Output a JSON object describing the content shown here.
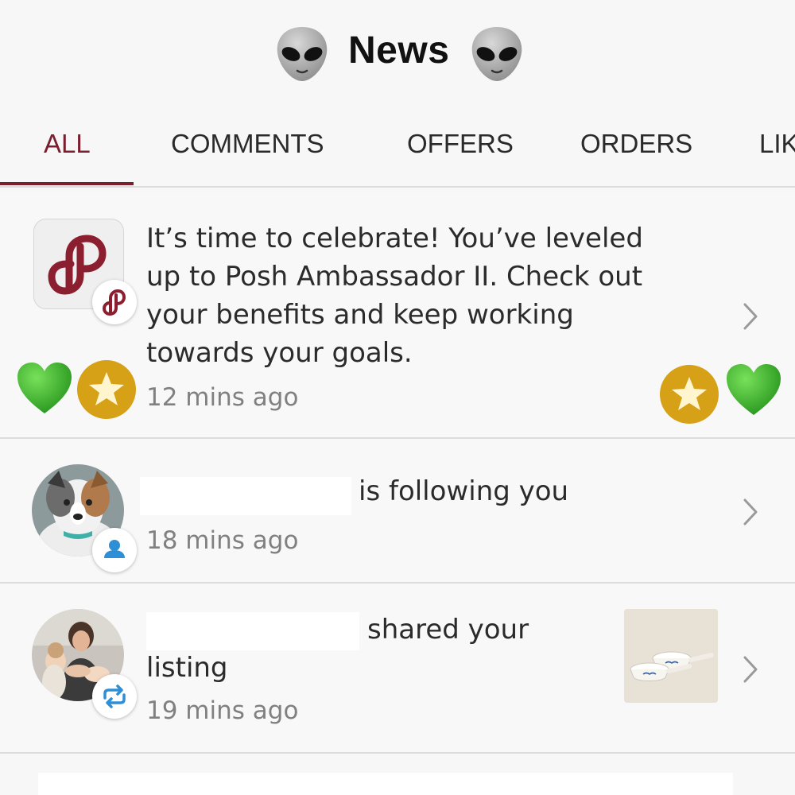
{
  "header": {
    "title": "News",
    "left_icon": "alien-emoji-icon",
    "right_icon": "alien-emoji-icon"
  },
  "tabs": [
    {
      "label": "ALL",
      "active": true
    },
    {
      "label": "COMMENTS",
      "active": false
    },
    {
      "label": "OFFERS",
      "active": false
    },
    {
      "label": "ORDERS",
      "active": false
    },
    {
      "label": "LIK",
      "active": false
    }
  ],
  "colors": {
    "accent": "#7b1e2e",
    "gold_badge": "#d6a017",
    "green_heart": "#3cb321",
    "meta_text": "#808080"
  },
  "notifications": [
    {
      "text": "It’s time to celebrate! You’ve leveled up to Posh Ambassador II. Check out your benefits and keep working towards your goals.",
      "lines": [
        "It’s time to celebrate! You’ve leveled",
        "up to Posh Ambassador II. Check out",
        "your benefits and keep working",
        "towards your goals."
      ],
      "time": "12 mins ago",
      "icon": "poshmark-logo-icon",
      "badge_icon": "poshmark-badge-icon",
      "decorations": [
        "green-heart-icon",
        "gold-star-icon"
      ]
    },
    {
      "text": "is following you",
      "time": "18 mins ago",
      "icon": "avatar",
      "badge_icon": "person-icon"
    },
    {
      "text_line1": "shared your",
      "text_line2": "listing",
      "time": "19 mins ago",
      "icon": "avatar",
      "badge_icon": "share-icon"
    }
  ]
}
